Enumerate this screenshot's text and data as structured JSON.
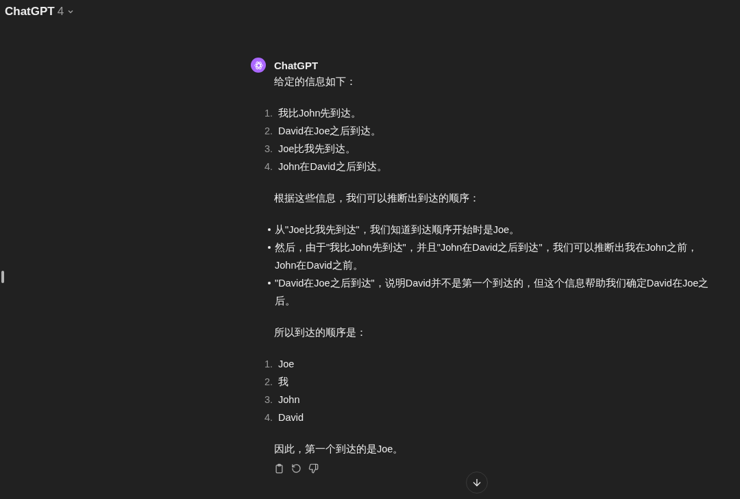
{
  "header": {
    "title": "ChatGPT",
    "version": "4"
  },
  "message": {
    "author": "ChatGPT",
    "blocks": [
      {
        "kind": "paragraph",
        "text": "给定的信息如下："
      },
      {
        "kind": "ordered",
        "items": [
          {
            "number": "1.",
            "text": "我比John先到达。"
          },
          {
            "number": "2.",
            "text": "David在Joe之后到达。"
          },
          {
            "number": "3.",
            "text": "Joe比我先到达。"
          },
          {
            "number": "4.",
            "text": "John在David之后到达。"
          }
        ]
      },
      {
        "kind": "paragraph",
        "text": "根据这些信息，我们可以推断出到达的顺序："
      },
      {
        "kind": "bullets",
        "items": [
          {
            "text": "从\"Joe比我先到达\"，我们知道到达顺序开始时是Joe。"
          },
          {
            "text": "然后，由于\"我比John先到达\"，并且\"John在David之后到达\"，我们可以推断出我在John之前，John在David之前。"
          },
          {
            "text": "\"David在Joe之后到达\"，说明David并不是第一个到达的，但这个信息帮助我们确定David在Joe之后。"
          }
        ]
      },
      {
        "kind": "paragraph",
        "text": "所以到达的顺序是："
      },
      {
        "kind": "ordered",
        "items": [
          {
            "number": "1.",
            "text": "Joe"
          },
          {
            "number": "2.",
            "text": "我"
          },
          {
            "number": "3.",
            "text": "John"
          },
          {
            "number": "4.",
            "text": "David"
          }
        ]
      },
      {
        "kind": "paragraph",
        "text": "因此，第一个到达的是Joe。"
      }
    ]
  }
}
